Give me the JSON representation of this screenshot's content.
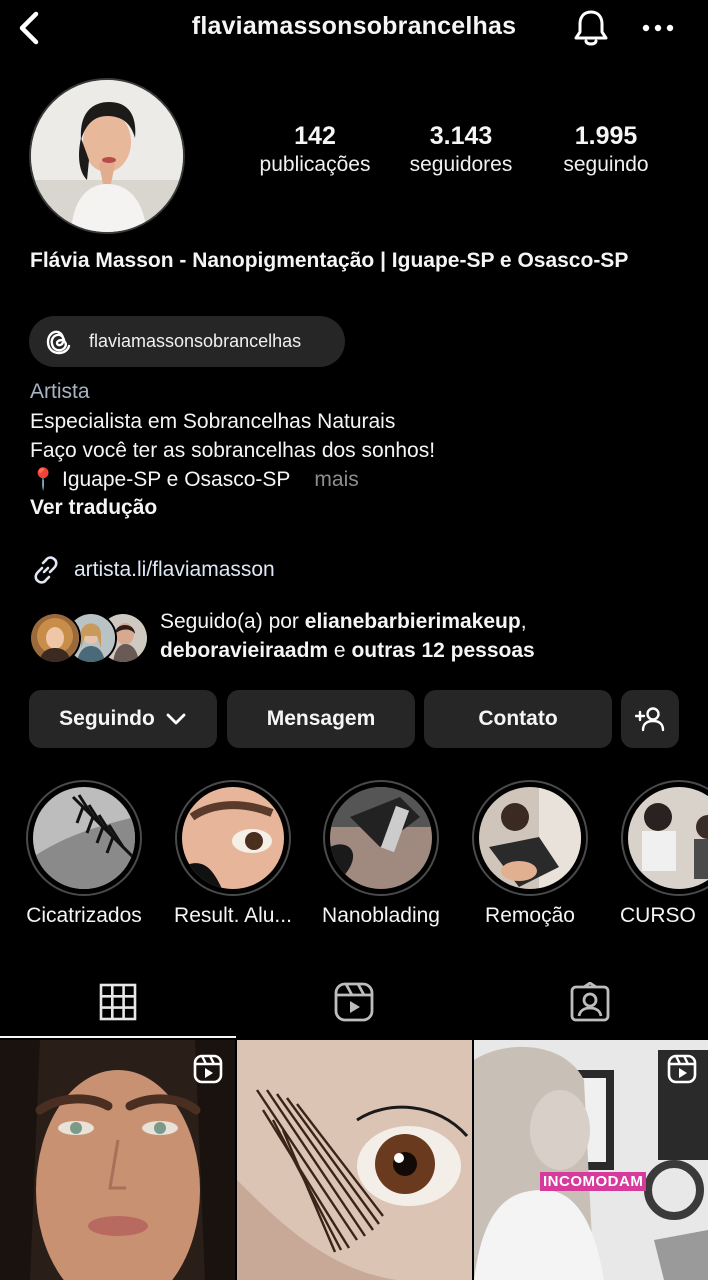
{
  "header": {
    "username": "flaviamassonsobrancelhas"
  },
  "stats": [
    {
      "value": "142",
      "label": "publicações"
    },
    {
      "value": "3.143",
      "label": "seguidores"
    },
    {
      "value": "1.995",
      "label": "seguindo"
    }
  ],
  "profile": {
    "full_name": "Flávia Masson - Nanopigmentação | Iguape-SP e Osasco-SP",
    "threads_handle": "flaviamassonsobrancelhas",
    "category": "Artista",
    "bio": [
      "Especialista em Sobrancelhas Naturais",
      "Faço você ter as sobrancelhas dos sonhos!",
      "📍 Iguape-SP e Osasco-SP"
    ],
    "more_label": "mais",
    "see_translation": "Ver tradução",
    "link": "artista.li/flaviamasson"
  },
  "followed_by": {
    "prefix": "Seguido(a) por ",
    "user1": "elianebarbierimakeup",
    "sep": ",",
    "user2": "deboravieiraadm",
    "conj": " e ",
    "others": "outras 12 pessoas"
  },
  "actions": {
    "following": "Seguindo",
    "message": "Mensagem",
    "contact": "Contato"
  },
  "highlights": [
    {
      "label": "Cicatrizados"
    },
    {
      "label": "Result. Alu..."
    },
    {
      "label": "Nanoblading"
    },
    {
      "label": "Remoção"
    },
    {
      "label": "CURSO"
    }
  ],
  "posts": [
    {
      "overlay_text": ""
    },
    {
      "overlay_text": ""
    },
    {
      "overlay_text": "INCOMODAM"
    }
  ],
  "icons": {
    "back": "chevron-left-icon",
    "bell": "bell-icon",
    "more": "more-horizontal-icon",
    "threads": "threads-icon",
    "link": "link-icon",
    "add_person": "add-person-icon",
    "grid": "grid-icon",
    "reels": "reels-icon",
    "tagged": "tagged-icon"
  },
  "colors": {
    "background": "#000000",
    "button_bg": "#262626",
    "category": "#a8b4c4",
    "link": "#dfe7f5",
    "muted": "#8e8e8e"
  }
}
